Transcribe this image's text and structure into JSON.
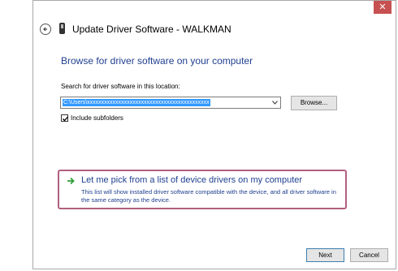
{
  "window": {
    "title": "Update Driver Software - WALKMAN",
    "close_label": "✕"
  },
  "main": {
    "heading": "Browse for driver software on your computer",
    "search_label": "Search for driver software in this location:",
    "path_value": "C:\\Users\\xxxxxxxxxxxxxxxxxxxxxxxxxxxxxxxxxxxxxxxxxxx",
    "browse_label": "Browse...",
    "include_subfolders_label": "Include subfolders",
    "include_subfolders_checked": true,
    "pick_title": "Let me pick from a list of device drivers on my computer",
    "pick_desc": "This list will show installed driver software compatible with the device, and all driver software in the same category as the device."
  },
  "footer": {
    "next_label": "Next",
    "cancel_label": "Cancel"
  },
  "colors": {
    "heading": "#1f3f8f",
    "highlight_border": "#b0607f",
    "close": "#c75050",
    "green_arrow": "#2e9e3a"
  }
}
